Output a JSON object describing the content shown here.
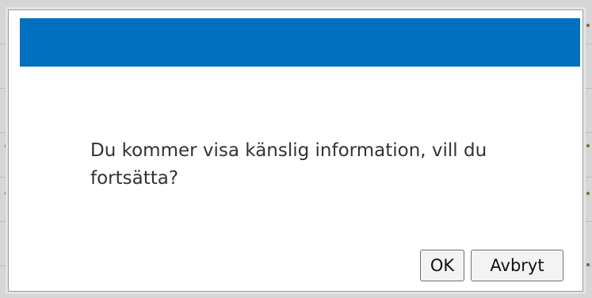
{
  "dialog": {
    "message": "Du kommer visa känslig information, vill du fortsätta?",
    "ok_label": "OK",
    "cancel_label": "Avbryt"
  },
  "colors": {
    "titlebar": "#0270c0",
    "dialog_background": "#ffffff",
    "text": "#333333"
  }
}
